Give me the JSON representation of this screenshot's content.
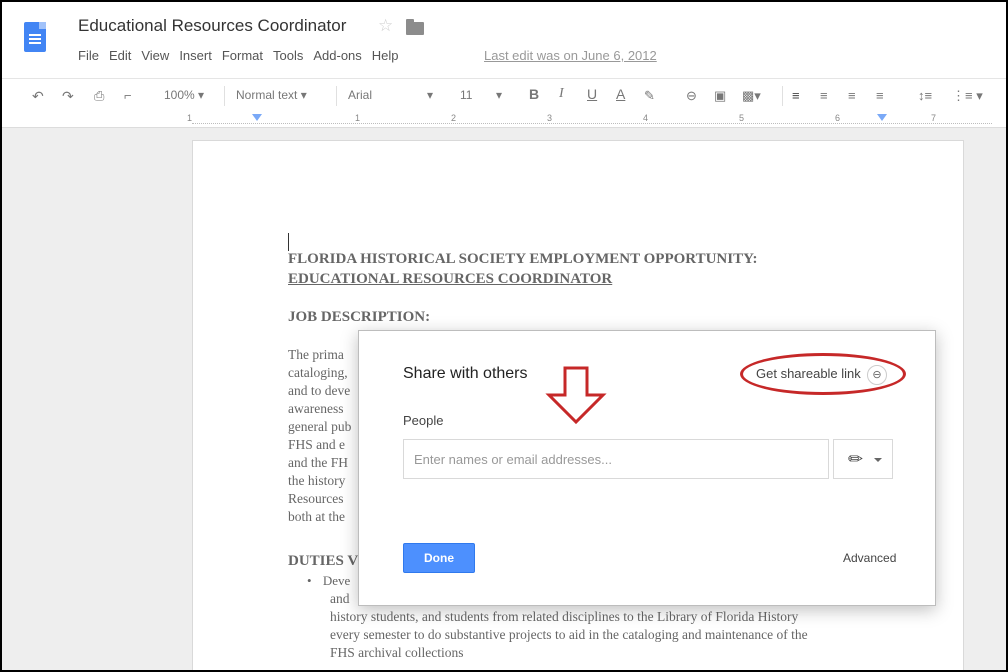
{
  "document": {
    "title": "Educational Resources Coordinator",
    "menu": [
      "File",
      "Edit",
      "View",
      "Insert",
      "Format",
      "Tools",
      "Add-ons",
      "Help"
    ],
    "last_edit": "Last edit was on June 6, 2012"
  },
  "toolbar": {
    "zoom": "100%",
    "style": "Normal text",
    "font": "Arial",
    "size": "11",
    "bold": "B",
    "italic": "I",
    "underline": "U",
    "textcolor": "A"
  },
  "ruler": {
    "numbers": [
      "1",
      "1",
      "2",
      "3",
      "4",
      "5",
      "6",
      "7"
    ]
  },
  "page": {
    "heading1": "FLORIDA HISTORICAL SOCIETY EMPLOYMENT OPPORTUNITY:",
    "heading2": "EDUCATIONAL RESOURCES COORDINATOR",
    "job_desc": "JOB DESCRIPTION:",
    "lines": [
      "The prima",
      "cataloging,",
      "and to deve",
      "awareness",
      "general pub",
      "FHS and e",
      "and the FH",
      "the history",
      "Resources",
      "both at the"
    ],
    "duties": "DUTIES V",
    "bullet_start": "Deve",
    "line_and": "and",
    "bullet_lines": [
      "history students, and students from related disciplines to the Library of Florida History",
      "every semester to do substantive projects to aid in the cataloging and maintenance of the",
      "FHS archival collections"
    ]
  },
  "dialog": {
    "title": "Share with others",
    "get_link": "Get shareable link",
    "people_label": "People",
    "input_placeholder": "Enter names or email addresses...",
    "done": "Done",
    "advanced": "Advanced"
  },
  "colors": {
    "accent": "#4d90fe",
    "annotation": "#c62828"
  }
}
